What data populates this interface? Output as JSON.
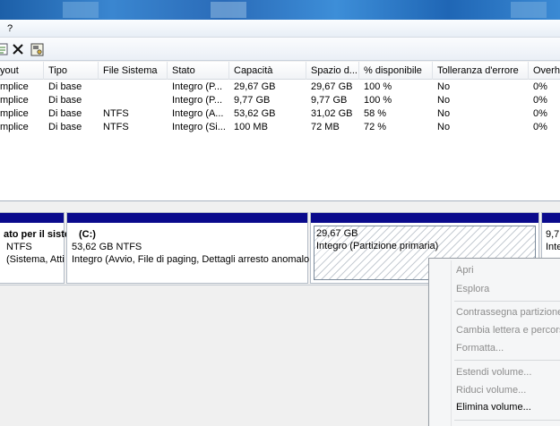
{
  "menu": {
    "help_label": "?"
  },
  "toolbar": {
    "properties_icon": "properties-icon",
    "delete_icon": "delete-icon",
    "settings_icon": "disk-properties-icon"
  },
  "volume_list": {
    "columns": [
      "yout",
      "Tipo",
      "File Sistema",
      "Stato",
      "Capacità",
      "Spazio d...",
      "% disponibile",
      "Tolleranza d'errore",
      "Overh"
    ],
    "rows": [
      [
        "mplice",
        "Di base",
        "",
        "Integro (P...",
        "29,67 GB",
        "29,67 GB",
        "100 %",
        "No",
        "0%"
      ],
      [
        "mplice",
        "Di base",
        "",
        "Integro (P...",
        "9,77 GB",
        "9,77 GB",
        "100 %",
        "No",
        "0%"
      ],
      [
        "mplice",
        "Di base",
        "NTFS",
        "Integro (A...",
        "53,62 GB",
        "31,02 GB",
        "58 %",
        "No",
        "0%"
      ],
      [
        "mplice",
        "Di base",
        "NTFS",
        "Integro (Si...",
        "100 MB",
        "72 MB",
        "72 %",
        "No",
        "0%"
      ]
    ]
  },
  "disk_map": {
    "reserved": {
      "line1": "ato per il siste",
      "line2": "NTFS",
      "line3": "(Sistema, Atti"
    },
    "c_drive": {
      "line1": "(C:)",
      "line2": "53,62 GB NTFS",
      "line3": "Integro (Avvio, File di paging, Dettagli arresto anomalo"
    },
    "partition1": {
      "line1": "29,67 GB",
      "line2": "Integro (Partizione primaria)"
    },
    "partition2": {
      "line1": "9,7",
      "line2": "Inte"
    }
  },
  "context_menu": {
    "items": [
      {
        "label": "Apri",
        "enabled": false
      },
      {
        "label": "Esplora",
        "enabled": false
      },
      {
        "label": "Contrassegna partizione",
        "enabled": false
      },
      {
        "label": "Cambia lettera e percorso",
        "enabled": false
      },
      {
        "label": "Formatta...",
        "enabled": false
      },
      {
        "label": "Estendi volume...",
        "enabled": false
      },
      {
        "label": "Riduci volume...",
        "enabled": false
      },
      {
        "label": "Elimina volume...",
        "enabled": true
      }
    ]
  },
  "colors": {
    "volume_bar": "#0a0a8c",
    "disabled_text": "#8d8d8d"
  }
}
